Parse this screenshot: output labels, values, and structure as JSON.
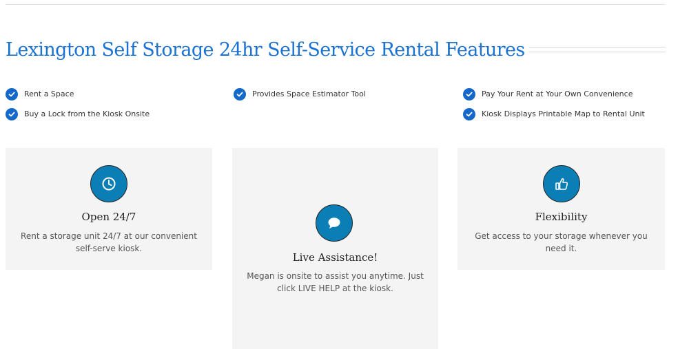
{
  "heading": {
    "title": "Lexington Self Storage 24hr Self-Service Rental Features"
  },
  "features": {
    "col1": [
      "Rent a Space",
      "Buy a Lock from the Kiosk Onsite"
    ],
    "col2": [
      "Provides Space Estimator Tool"
    ],
    "col3": [
      "Pay Your Rent at Your Own Convenience",
      "Kiosk Displays Printable Map to Rental Unit"
    ]
  },
  "cards": [
    {
      "icon": "clock-icon",
      "title": "Open 24/7",
      "text": "Rent a storage unit 24/7 at our convenient self-serve kiosk."
    },
    {
      "icon": "chat-bubble-icon",
      "title": "Live Assistance!",
      "text": "Megan is onsite to assist you anytime. Just click LIVE HELP at the kiosk."
    },
    {
      "icon": "thumbs-up-icon",
      "title": "Flexibility",
      "text": "Get access to your storage whenever you need it."
    }
  ],
  "colors": {
    "title": "#1a73d2",
    "check": "#1468c9",
    "icon_circle": "#0b7fb5",
    "card_bg": "#f4f4f4"
  }
}
